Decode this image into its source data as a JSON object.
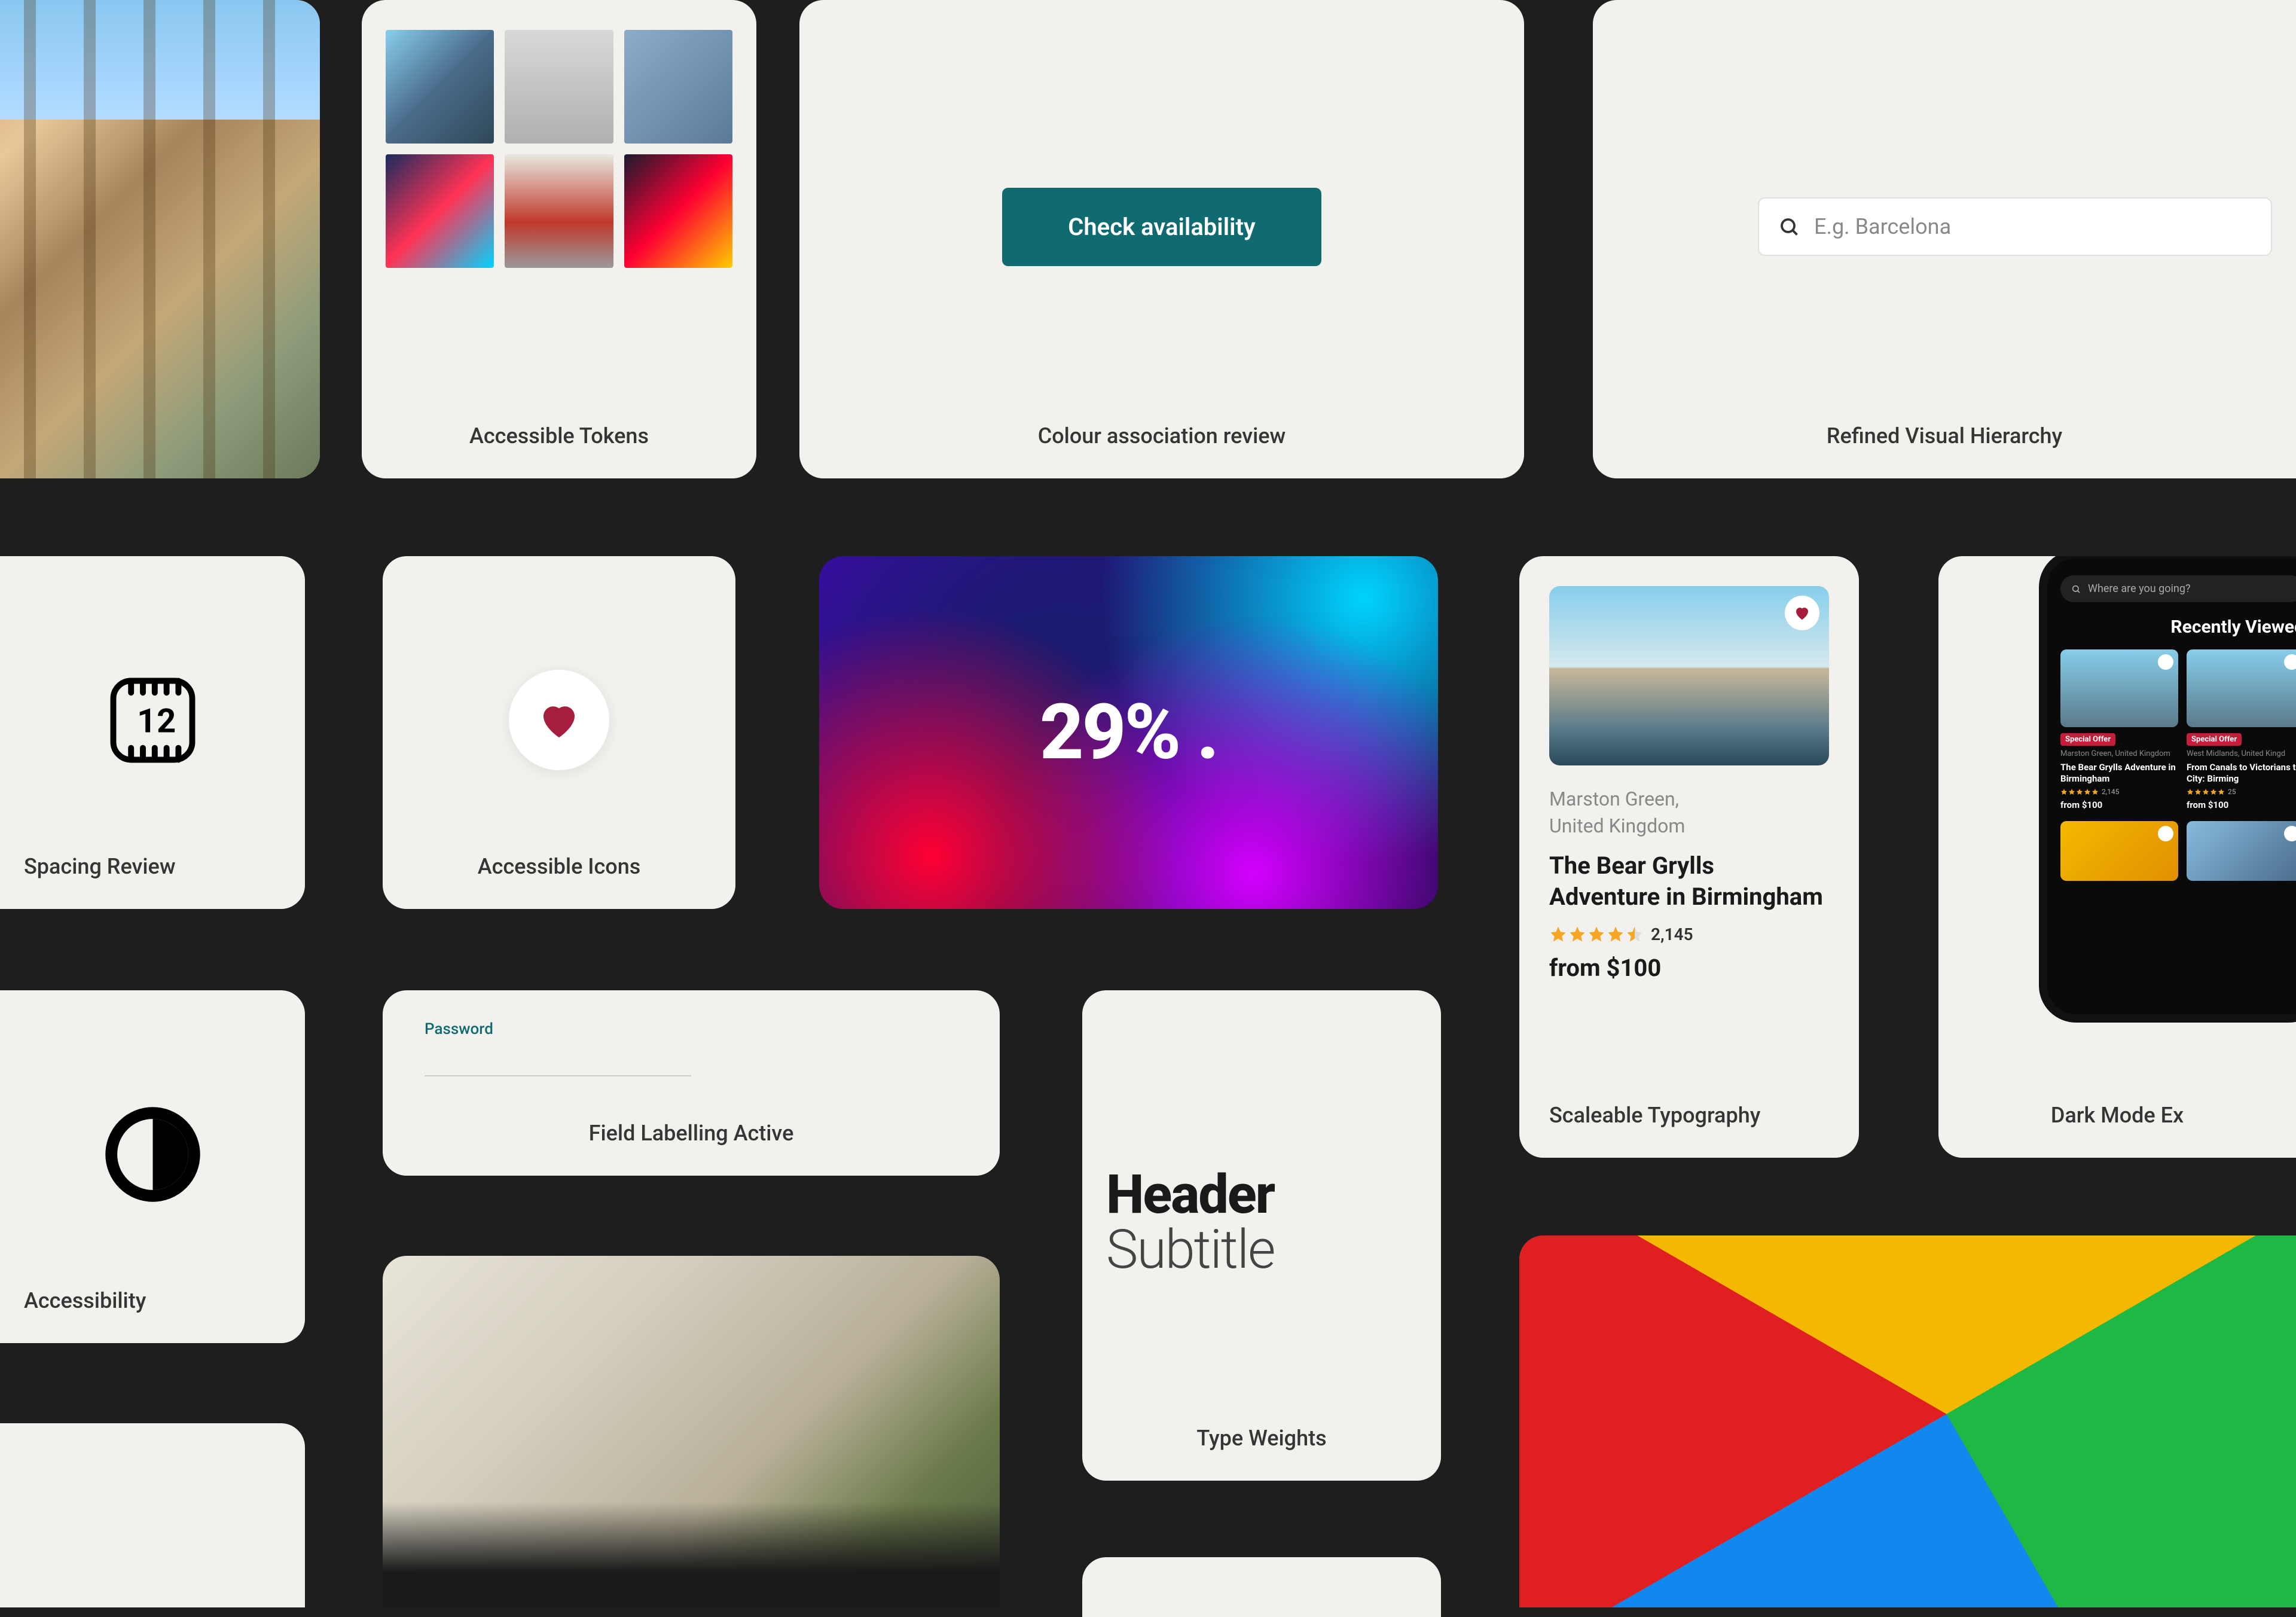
{
  "cards": {
    "tokens_label": "Accessible Tokens",
    "colour_label": "Colour association review",
    "hierarchy_label": "Refined Visual Hierarchy",
    "spacing_label": "Spacing Review",
    "icons_label": "Accessible Icons",
    "typo_label": "Scaleable Typography",
    "dark_label": "Dark Mode Ex",
    "a11y_label": "Accessibility",
    "field_label": "Field Labelling Active",
    "weights_label": "Type Weights"
  },
  "availability_button": "Check availability",
  "search": {
    "placeholder": "E.g. Barcelona"
  },
  "gradient_percent": "29% .",
  "listing": {
    "location_line1": "Marston Green,",
    "location_line2": "United Kingdom",
    "title": "The Bear Grylls Adventure in Birmingham",
    "review_count": "2,145",
    "price": "from $100",
    "star_rating": 4.5
  },
  "weights": {
    "header": "Header",
    "subtitle": "Subtitle"
  },
  "password": {
    "label": "Password",
    "value": ""
  },
  "phone": {
    "search_placeholder": "Where are you going?",
    "recently_viewed": "Recently Viewed",
    "badge": "Special Offer",
    "card1": {
      "location": "Marston Green, United Kingdom",
      "title": "The Bear Grylls Adventure in Birmingham",
      "rating_count": "2,145",
      "price": "from $100"
    },
    "card2": {
      "location": "West Midlands, United Kingd",
      "title": "From Canals to Victorians to City: Birming",
      "rating_count": "25",
      "price": "from $100"
    }
  }
}
